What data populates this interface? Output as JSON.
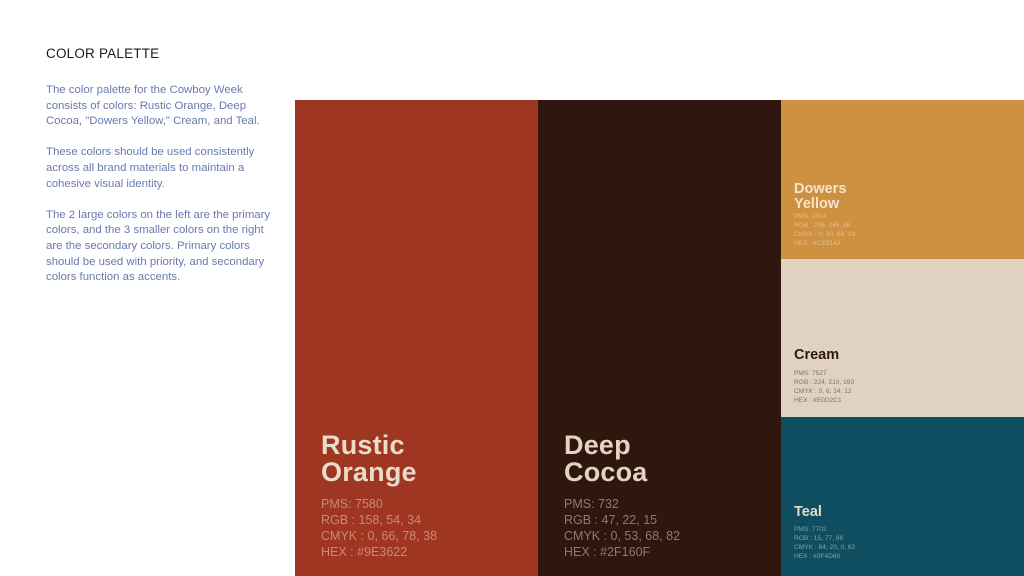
{
  "intro": {
    "title": "COLOR PALETTE",
    "paragraphs": [
      "The color palette for the Cowboy Week consists of colors: Rustic Orange, Deep Cocoa, \"Dowers Yellow,\" Cream, and Teal.",
      "These colors should be used consistently across all brand materials to maintain a cohesive visual identity.",
      "The 2 large colors on the left are the primary colors, and the 3 smaller colors on the right are the secondary colors. Primary colors should be used with priority, and secondary colors function as accents."
    ]
  },
  "swatches": {
    "rustic_orange": {
      "name_line1": "Rustic",
      "name_line2": "Orange",
      "pms": "PMS: 7580",
      "rgb": "RGB : 158, 54, 34",
      "cmyk": "CMYK : 0, 66, 78, 38",
      "hex": "HEX : #9E3622",
      "bg": "#9E3622",
      "name_color": "#E9DCC8",
      "spec_color": "#C98A76"
    },
    "deep_cocoa": {
      "name_line1": "Deep",
      "name_line2": "Cocoa",
      "pms": "PMS: 732",
      "rgb": "RGB : 47, 22, 15",
      "cmyk": "CMYK : 0, 53, 68, 82",
      "hex": "HEX : #2F160F",
      "bg": "#2F160F",
      "name_color": "#E3D4C0",
      "spec_color": "#8E7A70"
    },
    "dowers_yellow": {
      "name_line1": "Dowers",
      "name_line2": "Yellow",
      "pms": "PMS: 2014",
      "rgb": "RGB : 206, 145, 66",
      "cmyk": "CMYK : 0, 30, 68, 19",
      "hex": "HEX : #CE9142",
      "bg": "#CE9142",
      "name_color": "#F3E4CC",
      "spec_color": "#E6BE86"
    },
    "cream": {
      "name_line1": "Cream",
      "pms": "PMS: 7527",
      "rgb": "RGB : 224, 210, 193",
      "cmyk": "CMYK : 0, 6, 14, 12",
      "hex": "HEX : #E0D2C1",
      "bg": "#E0D2C1",
      "name_color": "#2F160F",
      "spec_color": "#8A6E62"
    },
    "teal": {
      "name_line1": "Teal",
      "pms": "PMS: 7702",
      "rgb": "RGB : 15, 77, 96",
      "cmyk": "CMYK : 84, 20, 0, 62",
      "hex": "HEX : #0F4D60",
      "bg": "#0F4D60",
      "name_color": "#E3D8C8",
      "spec_color": "#7FA3AE"
    }
  }
}
